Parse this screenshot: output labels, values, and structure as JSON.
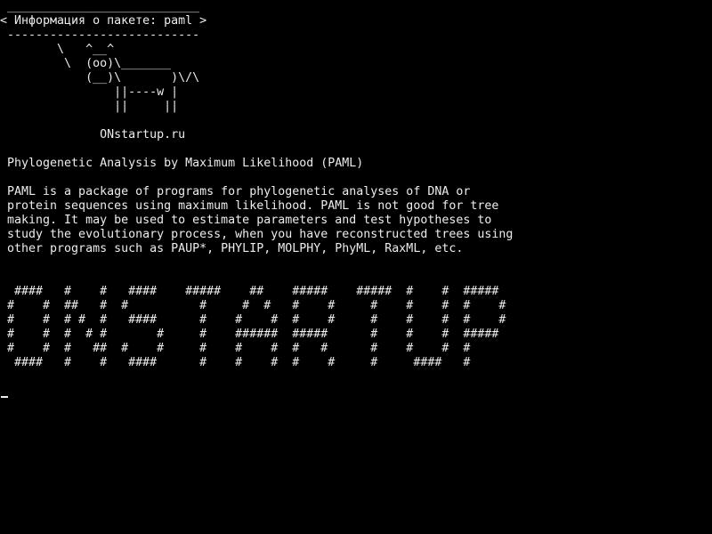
{
  "terminal": {
    "cowsay": {
      "border_top": " ___________________________",
      "bubble": "< Информация о пакете: paml >",
      "border_bottom": " ---------------------------",
      "cow": [
        "        \\   ^__^",
        "         \\  (oo)\\_______",
        "            (__)\\       )\\/\\",
        "                ||----w |",
        "                ||     ||"
      ]
    },
    "site_label": "              ONstartup.ru",
    "title_line": " Phylogenetic Analysis by Maximum Likelihood (PAML)",
    "description": [
      " PAML is a package of programs for phylogenetic analyses of DNA or",
      " protein sequences using maximum likelihood. PAML is not good for tree",
      " making. It may be used to estimate parameters and test hypotheses to",
      " study the evolutionary process, when you have reconstructed trees using",
      " other programs such as PAUP*, PHYLIP, MOLPHY, PhyML, RaxML, etc."
    ],
    "banner": [
      "  ####   #    #   ####    #####    ##    #####    #####  #    #  #####",
      " #    #  ##   #  #          #     #  #   #    #     #    #    #  #    #",
      " #    #  # #  #   ####      #    #    #  #    #     #    #    #  #    #",
      " #    #  #  # #       #     #    ######  #####      #    #    #  #####",
      " #    #  #   ##  #    #     #    #    #  #   #      #    #    #  #",
      "  ####   #    #   ####      #    #    #  #    #     #     ####   #"
    ]
  }
}
